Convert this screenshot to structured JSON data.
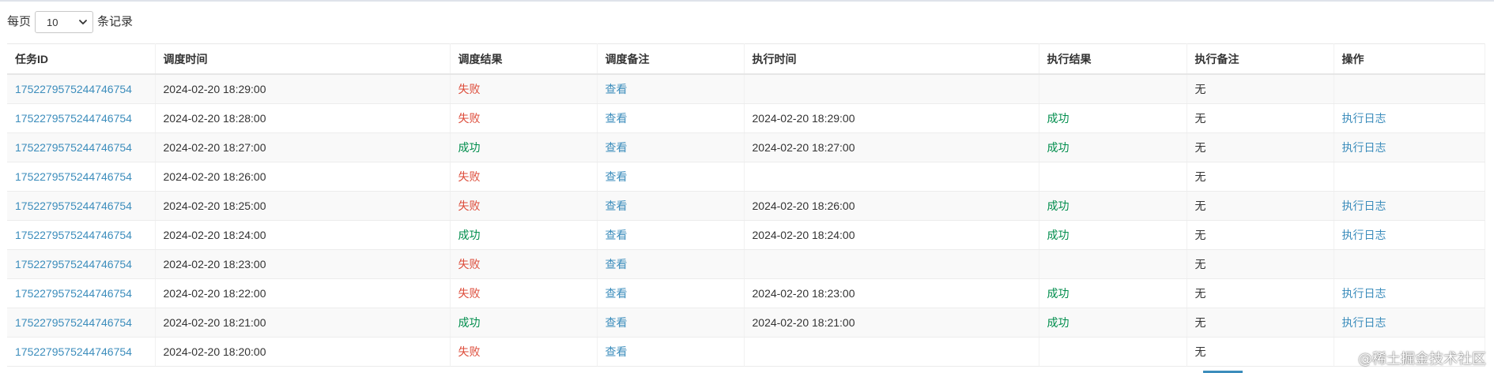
{
  "length_menu": {
    "prefix": "每页",
    "value": "10",
    "suffix": "条记录"
  },
  "columns": [
    "任务ID",
    "调度时间",
    "调度结果",
    "调度备注",
    "执行时间",
    "执行结果",
    "执行备注",
    "操作"
  ],
  "rows": [
    {
      "task_id": "1752279575244746754",
      "schedule_time": "2024-02-20 18:29:00",
      "schedule_result": "失败",
      "schedule_result_status": "fail",
      "schedule_note": "查看",
      "exec_time": "",
      "exec_result": "",
      "exec_note": "无",
      "action": ""
    },
    {
      "task_id": "1752279575244746754",
      "schedule_time": "2024-02-20 18:28:00",
      "schedule_result": "失败",
      "schedule_result_status": "fail",
      "schedule_note": "查看",
      "exec_time": "2024-02-20 18:29:00",
      "exec_result": "成功",
      "exec_note": "无",
      "action": "执行日志"
    },
    {
      "task_id": "1752279575244746754",
      "schedule_time": "2024-02-20 18:27:00",
      "schedule_result": "成功",
      "schedule_result_status": "ok",
      "schedule_note": "查看",
      "exec_time": "2024-02-20 18:27:00",
      "exec_result": "成功",
      "exec_note": "无",
      "action": "执行日志"
    },
    {
      "task_id": "1752279575244746754",
      "schedule_time": "2024-02-20 18:26:00",
      "schedule_result": "失败",
      "schedule_result_status": "fail",
      "schedule_note": "查看",
      "exec_time": "",
      "exec_result": "",
      "exec_note": "无",
      "action": ""
    },
    {
      "task_id": "1752279575244746754",
      "schedule_time": "2024-02-20 18:25:00",
      "schedule_result": "失败",
      "schedule_result_status": "fail",
      "schedule_note": "查看",
      "exec_time": "2024-02-20 18:26:00",
      "exec_result": "成功",
      "exec_note": "无",
      "action": "执行日志"
    },
    {
      "task_id": "1752279575244746754",
      "schedule_time": "2024-02-20 18:24:00",
      "schedule_result": "成功",
      "schedule_result_status": "ok",
      "schedule_note": "查看",
      "exec_time": "2024-02-20 18:24:00",
      "exec_result": "成功",
      "exec_note": "无",
      "action": "执行日志"
    },
    {
      "task_id": "1752279575244746754",
      "schedule_time": "2024-02-20 18:23:00",
      "schedule_result": "失败",
      "schedule_result_status": "fail",
      "schedule_note": "查看",
      "exec_time": "",
      "exec_result": "",
      "exec_note": "无",
      "action": ""
    },
    {
      "task_id": "1752279575244746754",
      "schedule_time": "2024-02-20 18:22:00",
      "schedule_result": "失败",
      "schedule_result_status": "fail",
      "schedule_note": "查看",
      "exec_time": "2024-02-20 18:23:00",
      "exec_result": "成功",
      "exec_note": "无",
      "action": "执行日志"
    },
    {
      "task_id": "1752279575244746754",
      "schedule_time": "2024-02-20 18:21:00",
      "schedule_result": "成功",
      "schedule_result_status": "ok",
      "schedule_note": "查看",
      "exec_time": "2024-02-20 18:21:00",
      "exec_result": "成功",
      "exec_note": "无",
      "action": "执行日志"
    },
    {
      "task_id": "1752279575244746754",
      "schedule_time": "2024-02-20 18:20:00",
      "schedule_result": "失败",
      "schedule_result_status": "fail",
      "schedule_note": "查看",
      "exec_time": "",
      "exec_result": "",
      "exec_note": "无",
      "action": ""
    }
  ],
  "colors": {
    "link": "#3c8dbc",
    "fail": "#dd4b39",
    "success": "#008d4c",
    "stripe": "#f9f9f9"
  },
  "watermark": "@稀土掘金技术社区"
}
